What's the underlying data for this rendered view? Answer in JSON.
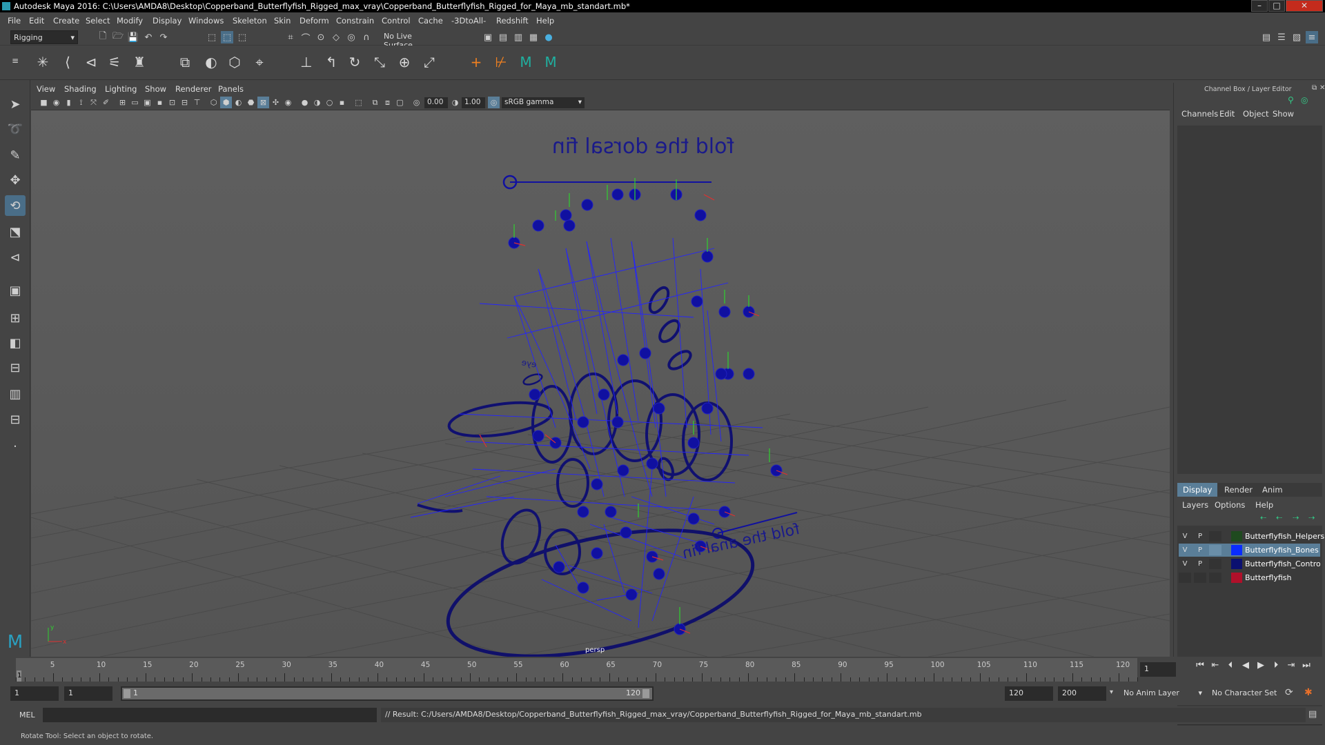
{
  "title": "Autodesk Maya 2016: C:\\Users\\AMDA8\\Desktop\\Copperband_Butterflyfish_Rigged_max_vray\\Copperband_Butterflyfish_Rigged_for_Maya_mb_standart.mb*",
  "window_buttons": [
    "–",
    "□",
    "✕"
  ],
  "menu": [
    "File",
    "Edit",
    "Create",
    "Select",
    "Modify",
    "Display",
    "Windows",
    "Skeleton",
    "Skin",
    "Deform",
    "Constrain",
    "Control",
    "Cache",
    "-3DtoAll-",
    "Redshift",
    "Help"
  ],
  "menuset": "Rigging",
  "live_surface": "No Live Surface",
  "viewport": {
    "menu": [
      "View",
      "Shading",
      "Lighting",
      "Show",
      "Renderer",
      "Panels"
    ],
    "near_value": "0.00",
    "far_value": "1.00",
    "color_space": "sRGB gamma",
    "camera_label": "persp",
    "annotation_dorsal": "fold the dorsal fin",
    "annotation_anal": "fold the anal fin",
    "annotation_small": "eye",
    "axis_y": "y",
    "axis_x": "x"
  },
  "channel_box": {
    "title": "Channel Box / Layer Editor",
    "menu": [
      "Channels",
      "Edit",
      "Object",
      "Show"
    ]
  },
  "layer_editor": {
    "tabs": [
      "Display",
      "Render",
      "Anim"
    ],
    "menu": [
      "Layers",
      "Options",
      "Help"
    ],
    "layers": [
      {
        "v": "V",
        "p": "P",
        "name": "Butterflyfish_Helpers",
        "color": "#1f4a1f",
        "selected": false
      },
      {
        "v": "V",
        "p": "P",
        "name": "Butterflyfish_Bones",
        "color": "#0a2cff",
        "selected": true
      },
      {
        "v": "V",
        "p": "P",
        "name": "Butterflyfish_Controllers",
        "color": "#0b1070",
        "selected": false
      },
      {
        "v": "",
        "p": "",
        "name": "Butterflyfish",
        "color": "#b0102a",
        "selected": false
      }
    ]
  },
  "timeline": {
    "ticks": [
      "5",
      "10",
      "15",
      "20",
      "25",
      "30",
      "35",
      "40",
      "45",
      "50",
      "55",
      "60",
      "65",
      "70",
      "75",
      "80",
      "85",
      "90",
      "95",
      "100",
      "105",
      "110",
      "115",
      "120"
    ],
    "current_frame_marker": "1",
    "current_frame": "1"
  },
  "range": {
    "start": "1",
    "playback_start": "1",
    "slider_start": "1",
    "slider_end": "120",
    "playback_end": "120",
    "end": "200",
    "anim_layer": "No Anim Layer",
    "character_set": "No Character Set"
  },
  "command": {
    "label": "MEL",
    "result": "// Result: C:/Users/AMDA8/Desktop/Copperband_Butterflyfish_Rigged_max_vray/Copperband_Butterflyfish_Rigged_for_Maya_mb_standart.mb"
  },
  "help_line": "Rotate Tool: Select an object to rotate."
}
